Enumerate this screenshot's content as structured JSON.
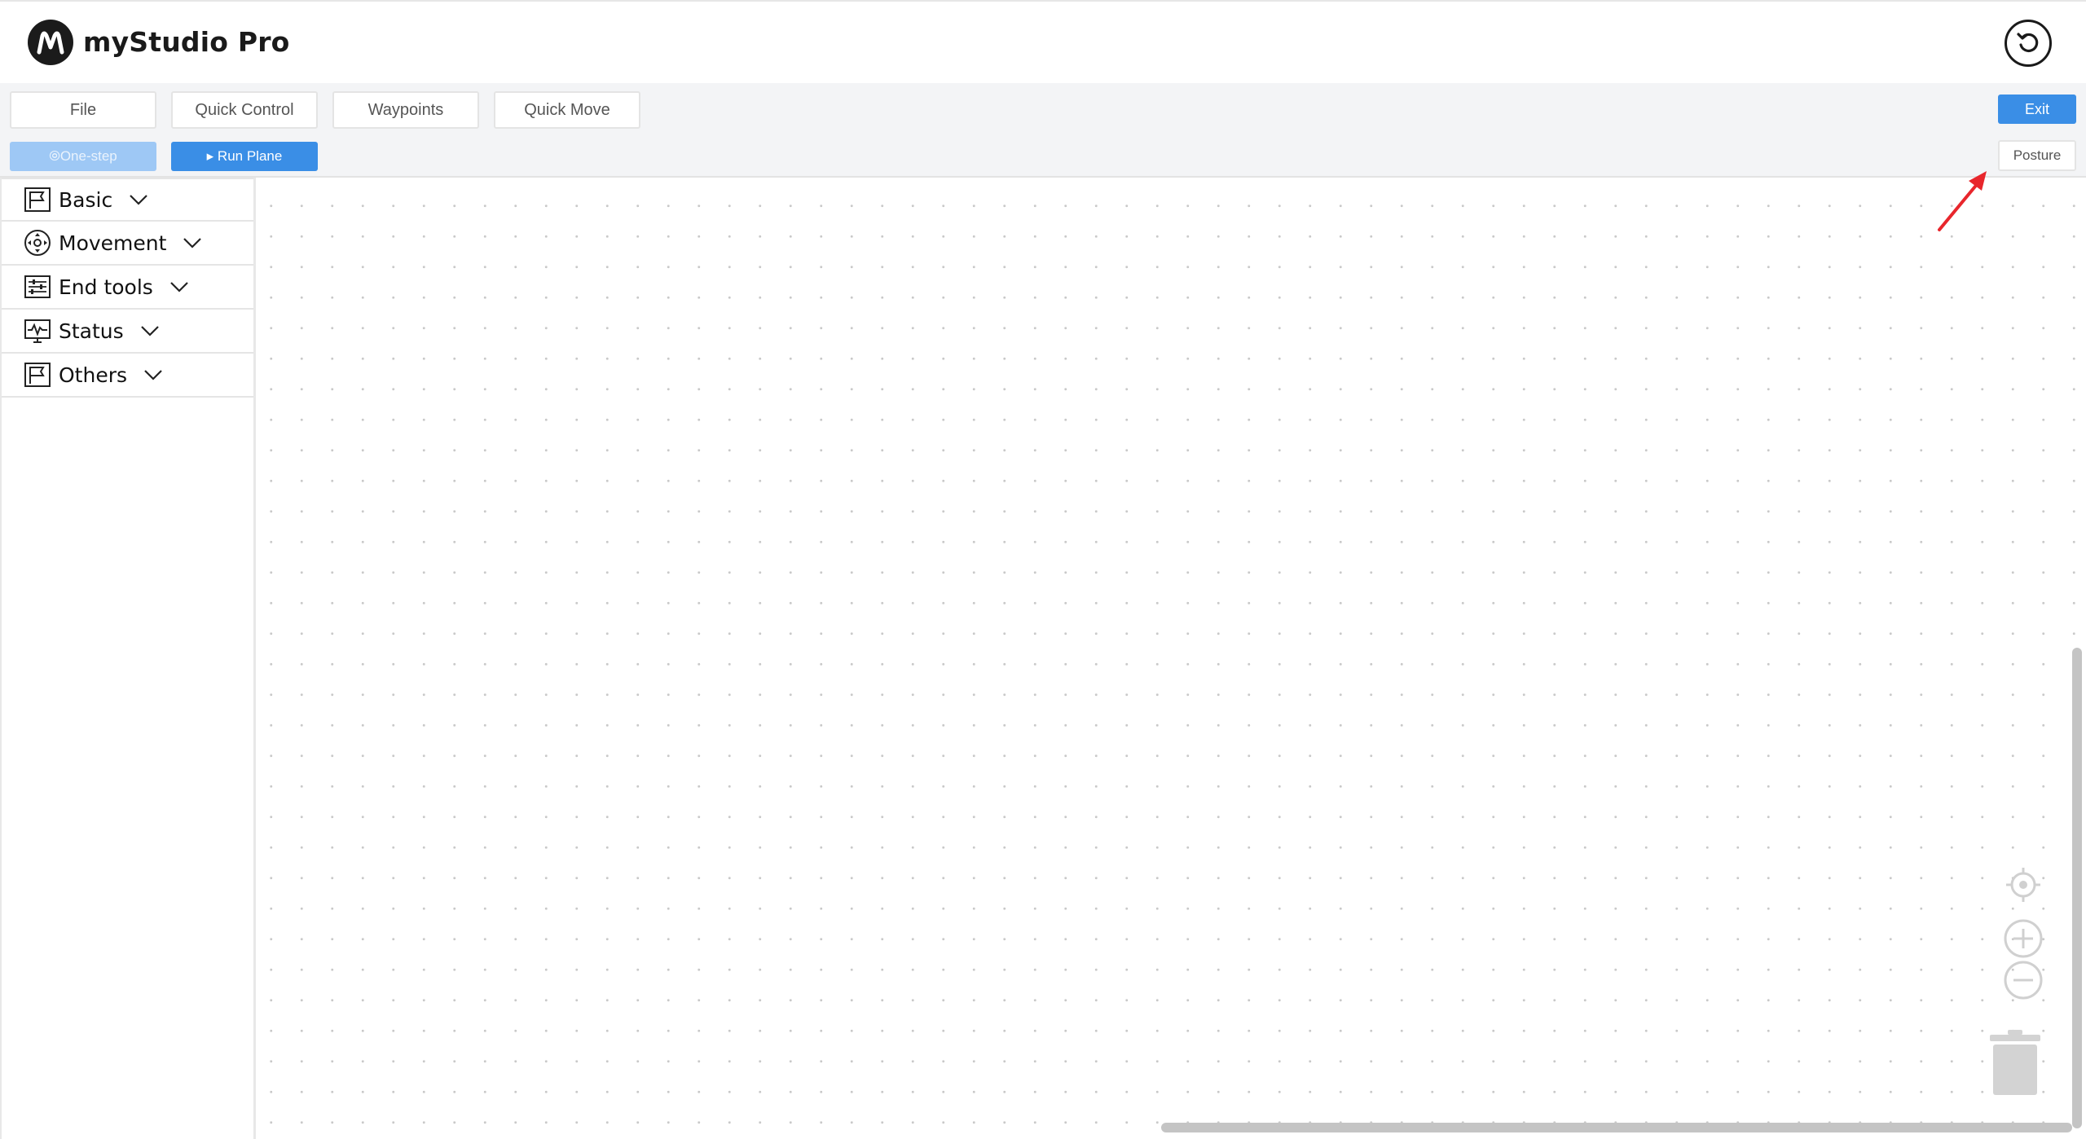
{
  "app": {
    "title": "myStudio Pro"
  },
  "menu": [
    {
      "label": "File"
    },
    {
      "label": "Quick Control"
    },
    {
      "label": "Waypoints"
    },
    {
      "label": "Quick Move"
    }
  ],
  "actions": {
    "exit_label": "Exit",
    "one_step_label": "⦾One-step",
    "run_plane_label": "▸ Run Plane",
    "posture_label": "Posture"
  },
  "sidebar": {
    "categories": [
      {
        "label": "Basic",
        "icon": "flag-icon"
      },
      {
        "label": "Movement",
        "icon": "move-icon"
      },
      {
        "label": "End tools",
        "icon": "sliders-icon"
      },
      {
        "label": "Status",
        "icon": "monitor-pulse-icon"
      },
      {
        "label": "Others",
        "icon": "flag-icon"
      }
    ]
  },
  "canvas_tools": [
    "locate-icon",
    "zoom-in-icon",
    "zoom-out-icon",
    "trash-icon"
  ],
  "colors": {
    "accent": "#3a8ee6",
    "accent_disabled": "#9ec8f5",
    "annotation": "#e8262c"
  }
}
